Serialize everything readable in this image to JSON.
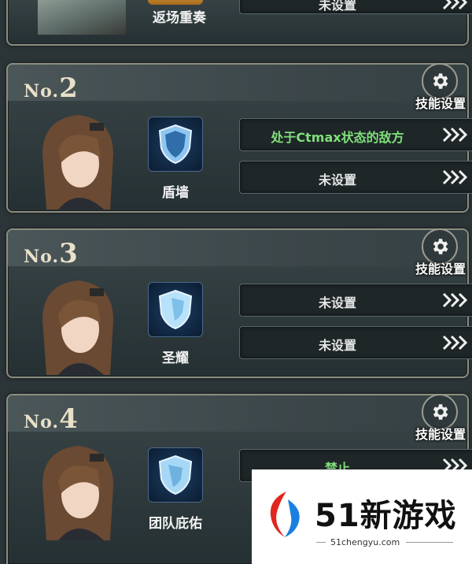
{
  "top_card": {
    "skill_name": "返场重奏",
    "condition": "未设置"
  },
  "slots": [
    {
      "prefix": "No.",
      "number": "2",
      "settings_label": "技能设置",
      "skill_name": "盾墙",
      "conditions": [
        "处于Ctmax状态的敌方",
        "未设置"
      ]
    },
    {
      "prefix": "No.",
      "number": "3",
      "settings_label": "技能设置",
      "skill_name": "圣耀",
      "conditions": [
        "未设置",
        "未设置"
      ]
    },
    {
      "prefix": "No.",
      "number": "4",
      "settings_label": "技能设置",
      "skill_name": "团队庇佑",
      "conditions": [
        "禁止"
      ]
    }
  ],
  "watermark": {
    "brand_number": "51",
    "brand_text": "新游戏",
    "url": "51chengyu.com"
  },
  "colors": {
    "highlight_condition": "#7fe07a",
    "card_border": "#8c8d7f",
    "background": "#2b3437"
  },
  "icons": {
    "settings": "gear-icon",
    "arrows": "triple-chevron-right-icon",
    "skill": "shield-icon"
  }
}
